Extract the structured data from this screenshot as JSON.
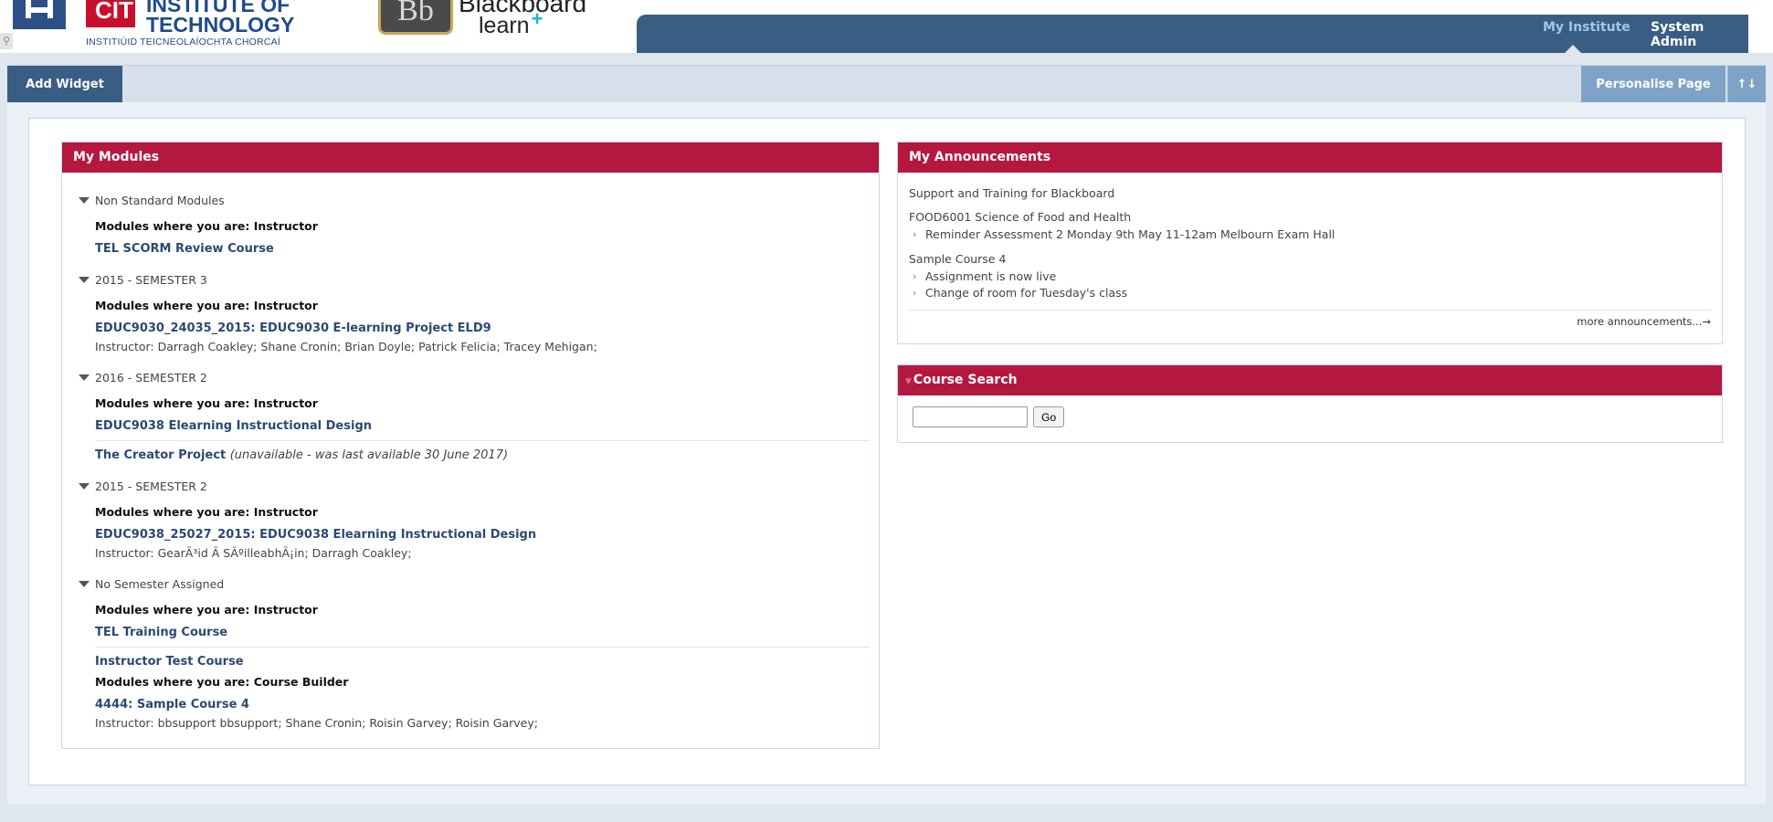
{
  "header": {
    "institute_line1": "INSTITUTE OF",
    "institute_line2": "TECHNOLOGY",
    "cit_short": "CIT",
    "institute_irish": "INSTITIÚID TEICNEOLAÍOCHTA CHORCAÍ",
    "bb_monogram": "Bb",
    "bb_brand": "Blackboard",
    "bb_product": "learn",
    "bb_plus": "+",
    "nav": {
      "my_institute": "My Institute",
      "system_admin": "System Admin"
    }
  },
  "toolbar": {
    "add_widget": "Add Widget",
    "personalise_page": "Personalise Page",
    "reorder_icon": "↑↓"
  },
  "my_modules": {
    "title": "My Modules",
    "terms": [
      {
        "name": "Non Standard Modules",
        "role": "Modules where you are: Instructor",
        "course": "TEL SCORM Review Course"
      },
      {
        "name": "2015 - SEMESTER 3",
        "role": "Modules where you are: Instructor",
        "course": "EDUC9030_24035_2015: EDUC9030 E-learning Project ELD9",
        "instructor_label": "Instructor:",
        "instructors": "Darragh Coakley;  Shane Cronin;  Brian Doyle;  Patrick Felicia;  Tracey Mehigan;"
      },
      {
        "name": "2016 - SEMESTER 2",
        "role": "Modules where you are: Instructor",
        "course": "EDUC9038 Elearning Instructional Design",
        "course2": "The Creator Project",
        "course2_note": "(unavailable - was last available 30 June 2017)"
      },
      {
        "name": "2015 - SEMESTER 2",
        "role": "Modules where you are: Instructor",
        "course": "EDUC9038_25027_2015: EDUC9038 Elearning Instructional Design",
        "instructor_label": "Instructor:",
        "instructors": "GearÃ³id Ã SÃºilleabhÃ¡in;  Darragh Coakley;"
      },
      {
        "name": "No Semester Assigned",
        "role": "Modules where you are: Instructor",
        "course": "TEL Training Course",
        "course2": "Instructor Test Course",
        "role2": "Modules where you are: Course Builder",
        "course3": "4444: Sample Course 4",
        "instructor_label": "Instructor:",
        "instructors": "bbsupport bbsupport;  Shane Cronin;  Roisin Garvey;  Roisin Garvey;"
      }
    ]
  },
  "announcements": {
    "title": "My Announcements",
    "group1": "Support and Training for Blackboard",
    "group2": "FOOD6001 Science of Food and Health",
    "group2_items": [
      "Reminder Assessment 2 Monday 9th May 11-12am Melbourn Exam Hall"
    ],
    "group3": "Sample Course 4",
    "group3_items": [
      "Assignment is now live",
      "Change of room for Tuesday's class"
    ],
    "more": "more announcements...→"
  },
  "course_search": {
    "title": "Course Search",
    "input_value": "",
    "go_label": "Go"
  },
  "colors": {
    "module_header": "#b5183f",
    "nav_bar": "#3a5d83",
    "link": "#2b4a73",
    "nav_active": "#9ec7ec"
  }
}
